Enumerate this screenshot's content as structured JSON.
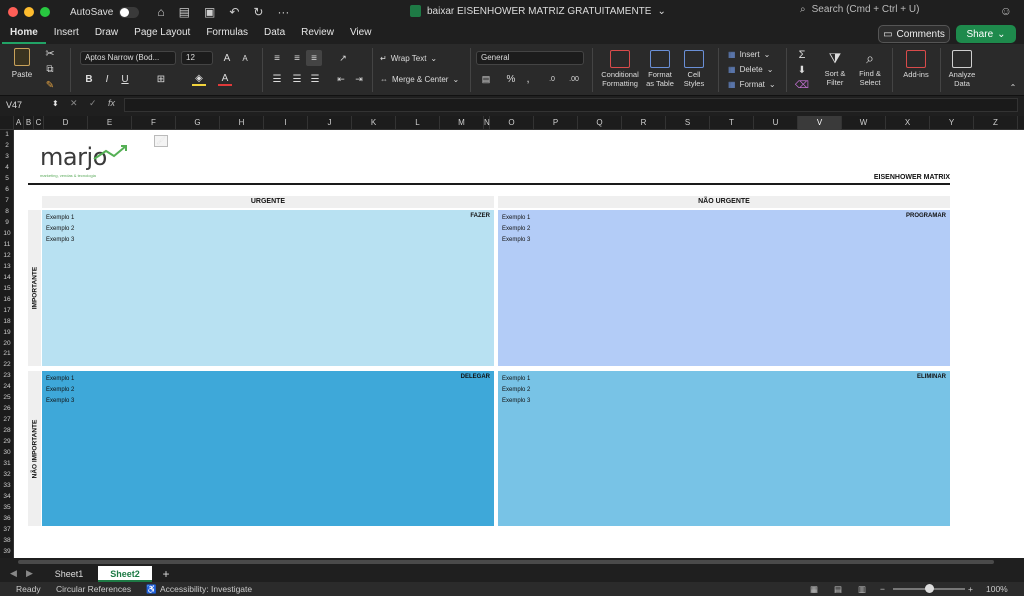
{
  "window": {
    "autosave_label": "AutoSave",
    "doc_title": "baixar EISENHOWER MATRIZ GRATUITAMENTE",
    "search_placeholder": "Search (Cmd + Ctrl + U)",
    "traffic_colors": [
      "#ff5f57",
      "#febc2e",
      "#28c840"
    ]
  },
  "tabs": [
    "Home",
    "Insert",
    "Draw",
    "Page Layout",
    "Formulas",
    "Data",
    "Review",
    "View"
  ],
  "active_tab": "Home",
  "comments_label": "Comments",
  "share_label": "Share",
  "ribbon": {
    "paste": "Paste",
    "font_name": "Aptos Narrow (Bod...",
    "font_size": "12",
    "wrap_text": "Wrap Text",
    "merge_center": "Merge & Center",
    "number_format": "General",
    "conditional_formatting": [
      "Conditional",
      "Formatting"
    ],
    "format_as_table": [
      "Format",
      "as Table"
    ],
    "cell_styles": [
      "Cell",
      "Styles"
    ],
    "insert": "Insert",
    "delete": "Delete",
    "format": "Format",
    "sort_filter": [
      "Sort &",
      "Filter"
    ],
    "find_select": [
      "Find &",
      "Select"
    ],
    "addins": "Add-ins",
    "analyze_data": [
      "Analyze",
      "Data"
    ]
  },
  "formula_bar": {
    "name_box": "V47",
    "fx": "fx",
    "content": ""
  },
  "columns": [
    "A",
    "B",
    "C",
    "D",
    "E",
    "F",
    "G",
    "H",
    "I",
    "J",
    "K",
    "L",
    "M",
    "N",
    "O",
    "P",
    "Q",
    "R",
    "S",
    "T",
    "U",
    "V",
    "W",
    "X",
    "Y",
    "Z"
  ],
  "selected_column": "V",
  "rows": [
    "1",
    "2",
    "3",
    "4",
    "5",
    "6",
    "7",
    "8",
    "9",
    "10",
    "11",
    "12",
    "13",
    "14",
    "15",
    "16",
    "17",
    "18",
    "19",
    "20",
    "21",
    "22",
    "23",
    "24",
    "25",
    "26",
    "27",
    "28",
    "29",
    "30",
    "31",
    "32",
    "33",
    "34",
    "35",
    "36",
    "37",
    "38",
    "39"
  ],
  "sheet": {
    "logo_text": "marjo",
    "logo_tagline": "marketing, vendas & tecnologia",
    "matrix_title": "EISENHOWER MATRIX",
    "col_header_urgent": "URGENTE",
    "col_header_not_urgent": "NÃO URGENTE",
    "row_header_important": "IMPORTANTE",
    "row_header_not_important": "NÃO IMPORTANTE",
    "quadrants": [
      {
        "label": "FAZER",
        "items": [
          "Exemplo 1",
          "Exemplo 2",
          "Exemplo 3"
        ],
        "color": "#b8e1f2"
      },
      {
        "label": "PROGRAMAR",
        "items": [
          "Exemplo 1",
          "Exemplo 2",
          "Exemplo 3"
        ],
        "color": "#b3ccf7"
      },
      {
        "label": "DELEGAR",
        "items": [
          "Exemplo 1",
          "Exemplo 2",
          "Exemplo 3"
        ],
        "color": "#3ea8d9"
      },
      {
        "label": "ELIMINAR",
        "items": [
          "Exemplo 1",
          "Exemplo 2",
          "Exemplo 3"
        ],
        "color": "#78c3e6"
      }
    ]
  },
  "sheet_tabs": [
    "Sheet1",
    "Sheet2"
  ],
  "active_sheet": "Sheet2",
  "status": {
    "ready": "Ready",
    "circular": "Circular References",
    "accessibility": "Accessibility: Investigate",
    "zoom": "100%"
  }
}
